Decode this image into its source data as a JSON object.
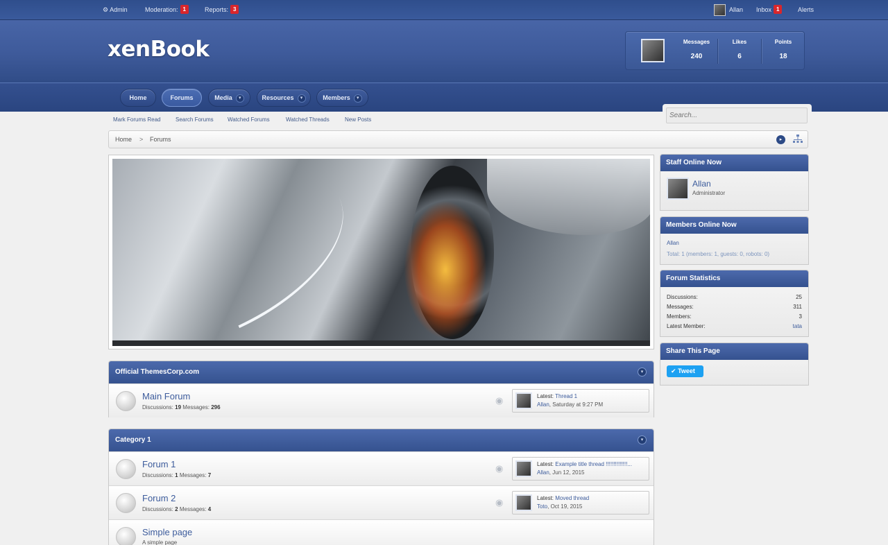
{
  "topbar": {
    "admin": "Admin",
    "moderation_label": "Moderation:",
    "moderation_count": "1",
    "reports_label": "Reports:",
    "reports_count": "3",
    "user": "Allan",
    "inbox_label": "Inbox",
    "inbox_count": "1",
    "alerts_label": "Alerts"
  },
  "header": {
    "logo": "xenBook",
    "stats": [
      {
        "label": "Messages",
        "value": "240"
      },
      {
        "label": "Likes",
        "value": "6"
      },
      {
        "label": "Points",
        "value": "18"
      }
    ]
  },
  "nav": {
    "tabs": [
      {
        "label": "Home"
      },
      {
        "label": "Forums",
        "active": true
      },
      {
        "label": "Media",
        "dropdown": true
      },
      {
        "label": "Resources",
        "dropdown": true
      },
      {
        "label": "Members",
        "dropdown": true
      }
    ],
    "dropdown_glyph": "▾"
  },
  "subnav": [
    "Mark Forums Read",
    "Search Forums",
    "Watched Forums",
    "Watched Threads",
    "New Posts"
  ],
  "search": {
    "placeholder": "Search..."
  },
  "breadcrumb": {
    "home": "Home",
    "separator": ">",
    "current": "Forums"
  },
  "categories": [
    {
      "title": "Official ThemesCorp.com",
      "forums": [
        {
          "title": "Main Forum",
          "discussions_label": "Discussions:",
          "discussions": "19",
          "messages_label": "Messages:",
          "messages": "296",
          "latest_label": "Latest:",
          "latest_thread": "Thread 1",
          "latest_user": "Allan",
          "latest_date": ", Saturday at 9:27 PM"
        }
      ]
    },
    {
      "title": "Category 1",
      "forums": [
        {
          "title": "Forum 1",
          "discussions_label": "Discussions:",
          "discussions": "1",
          "messages_label": "Messages:",
          "messages": "7",
          "latest_label": "Latest:",
          "latest_thread": "Example title thread !!!!!!!!!!!!!!...",
          "latest_user": "Allan",
          "latest_date": ", Jun 12, 2015"
        },
        {
          "title": "Forum 2",
          "discussions_label": "Discussions:",
          "discussions": "2",
          "messages_label": "Messages:",
          "messages": "4",
          "latest_label": "Latest:",
          "latest_thread": "Moved thread",
          "latest_user": "Toto",
          "latest_date": ", Oct 19, 2015"
        }
      ],
      "page": {
        "title": "Simple page",
        "description": "A simple page"
      }
    }
  ],
  "sidebar": {
    "staff": {
      "title": "Staff Online Now",
      "name": "Allan",
      "role": "Administrator"
    },
    "members_online": {
      "title": "Members Online Now",
      "member": "Allan",
      "total": "Total: 1 (members: 1, guests: 0, robots: 0)"
    },
    "stats": {
      "title": "Forum Statistics",
      "rows": [
        {
          "label": "Discussions:",
          "value": "25"
        },
        {
          "label": "Messages:",
          "value": "311"
        },
        {
          "label": "Members:",
          "value": "3"
        },
        {
          "label": "Latest Member:",
          "value": "tata"
        }
      ]
    },
    "share": {
      "title": "Share This Page",
      "tweet": "Tweet"
    }
  },
  "icons": {
    "admin": "gear-icon",
    "jump": "arrow-right-circle-icon",
    "sitemap": "sitemap-icon",
    "rss": "rss-icon",
    "toggle": "collapse-icon",
    "twitter": "twitter-bird-icon"
  },
  "colors": {
    "brand_blue": "#3e5a9a",
    "badge_red": "#d9262b",
    "link_blue": "#3d5c9c",
    "twitter": "#1da1f2"
  }
}
